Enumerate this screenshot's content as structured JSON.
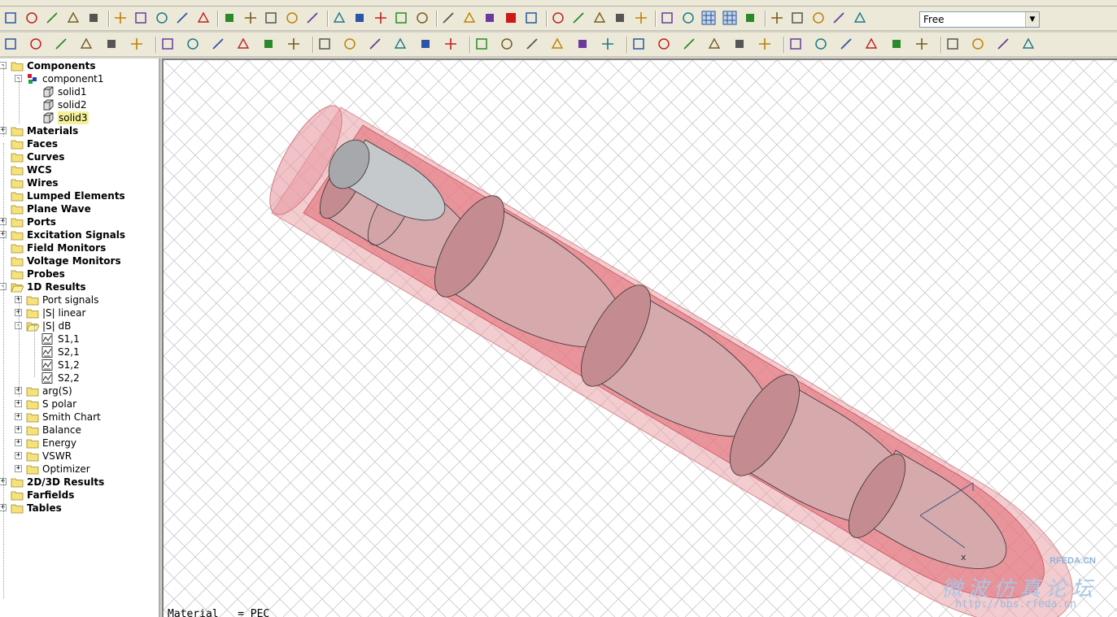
{
  "toolbar": {
    "view_mode": "Free",
    "row1_icons": [
      "open-folder-icon",
      "save-icon",
      "print-icon",
      "import-icon",
      "cut-icon",
      "paste-icon",
      "delete-icon",
      "undo-icon",
      "parameter-icon",
      "history-icon",
      "line-icon",
      "polyline-icon",
      "circle-icon",
      "ellipse-icon",
      "spline-icon",
      "edge-icon",
      "cross-edge-icon",
      "brick-icon",
      "pan-icon",
      "anchor-icon",
      "port-icon",
      "excitation-icon",
      "solver-icon",
      "stop-icon",
      "rotate-icon",
      "rotate-view-icon",
      "move-view-icon",
      "zoom-in-icon",
      "zoom-box-icon",
      "zoom-icon",
      "zoom-fit-icon",
      "glasses-icon",
      "axes-icon",
      "grid-icon",
      "wireframe-icon",
      "shade-icon",
      "cut-plane-icon",
      "transparency-icon",
      "link-icon",
      "unlink-icon"
    ],
    "row2_icons": [
      "pick-point-icon",
      "sphere-icon",
      "cylinder-icon",
      "cone-icon",
      "torus-icon",
      "ellipsoid-icon",
      "rotate-profile-icon",
      "extrude-icon",
      "loft-icon",
      "shape-icon",
      "boolean-add-icon",
      "boolean-subtract-icon",
      "boolean-intersect-icon",
      "boolean-insert-icon",
      "transform-icon",
      "align-icon",
      "mirror-icon",
      "units-icon",
      "background-icon",
      "boundary-icon",
      "symmetry-icon",
      "mesh-icon",
      "mesh-view-icon",
      "monitor-icon",
      "signal-icon",
      "template-icon",
      "time-domain-icon",
      "frequency-domain-icon",
      "eigenmode-icon",
      "result-icon",
      "coordinate-icon",
      "local-wcs-icon",
      "move-wcs-icon",
      "rotate-wcs-icon",
      "align-wcs-icon",
      "store-wcs-icon",
      "group-icon",
      "hide-icon",
      "show-icon",
      "properties-icon"
    ]
  },
  "tree": {
    "nodes": [
      {
        "label": "Components",
        "bold": true,
        "level": 0,
        "expander": "-",
        "icon": "folder-icon"
      },
      {
        "label": "component1",
        "bold": false,
        "level": 1,
        "expander": "-",
        "icon": "component-icon"
      },
      {
        "label": "solid1",
        "bold": false,
        "level": 2,
        "expander": "",
        "icon": "solid-icon"
      },
      {
        "label": "solid2",
        "bold": false,
        "level": 2,
        "expander": "",
        "icon": "solid-icon"
      },
      {
        "label": "solid3",
        "bold": false,
        "level": 2,
        "expander": "",
        "icon": "solid-icon",
        "selected": true
      },
      {
        "label": "Materials",
        "bold": true,
        "level": 0,
        "expander": "+",
        "icon": "folder-icon"
      },
      {
        "label": "Faces",
        "bold": true,
        "level": 0,
        "expander": "",
        "icon": "folder-icon"
      },
      {
        "label": "Curves",
        "bold": true,
        "level": 0,
        "expander": "",
        "icon": "folder-icon"
      },
      {
        "label": "WCS",
        "bold": true,
        "level": 0,
        "expander": "",
        "icon": "folder-icon"
      },
      {
        "label": "Wires",
        "bold": true,
        "level": 0,
        "expander": "",
        "icon": "folder-icon"
      },
      {
        "label": "Lumped Elements",
        "bold": true,
        "level": 0,
        "expander": "",
        "icon": "folder-icon"
      },
      {
        "label": "Plane Wave",
        "bold": true,
        "level": 0,
        "expander": "",
        "icon": "folder-icon"
      },
      {
        "label": "Ports",
        "bold": true,
        "level": 0,
        "expander": "+",
        "icon": "folder-icon"
      },
      {
        "label": "Excitation Signals",
        "bold": true,
        "level": 0,
        "expander": "+",
        "icon": "folder-icon"
      },
      {
        "label": "Field Monitors",
        "bold": true,
        "level": 0,
        "expander": "",
        "icon": "folder-icon"
      },
      {
        "label": "Voltage Monitors",
        "bold": true,
        "level": 0,
        "expander": "",
        "icon": "folder-icon"
      },
      {
        "label": "Probes",
        "bold": true,
        "level": 0,
        "expander": "",
        "icon": "folder-icon"
      },
      {
        "label": "1D Results",
        "bold": true,
        "level": 0,
        "expander": "-",
        "icon": "folder-open-icon"
      },
      {
        "label": "Port signals",
        "bold": false,
        "level": 1,
        "expander": "+",
        "icon": "folder-icon"
      },
      {
        "label": "|S| linear",
        "bold": false,
        "level": 1,
        "expander": "+",
        "icon": "folder-icon"
      },
      {
        "label": "|S| dB",
        "bold": false,
        "level": 1,
        "expander": "-",
        "icon": "folder-open-icon"
      },
      {
        "label": "S1,1",
        "bold": false,
        "level": 2,
        "expander": "",
        "icon": "result-chart-icon"
      },
      {
        "label": "S2,1",
        "bold": false,
        "level": 2,
        "expander": "",
        "icon": "result-chart-icon"
      },
      {
        "label": "S1,2",
        "bold": false,
        "level": 2,
        "expander": "",
        "icon": "result-chart-icon"
      },
      {
        "label": "S2,2",
        "bold": false,
        "level": 2,
        "expander": "",
        "icon": "result-chart-icon"
      },
      {
        "label": "arg(S)",
        "bold": false,
        "level": 1,
        "expander": "+",
        "icon": "folder-icon"
      },
      {
        "label": "S polar",
        "bold": false,
        "level": 1,
        "expander": "+",
        "icon": "folder-icon"
      },
      {
        "label": "Smith Chart",
        "bold": false,
        "level": 1,
        "expander": "+",
        "icon": "folder-icon"
      },
      {
        "label": "Balance",
        "bold": false,
        "level": 1,
        "expander": "+",
        "icon": "folder-icon"
      },
      {
        "label": "Energy",
        "bold": false,
        "level": 1,
        "expander": "+",
        "icon": "folder-icon"
      },
      {
        "label": "VSWR",
        "bold": false,
        "level": 1,
        "expander": "+",
        "icon": "folder-icon"
      },
      {
        "label": "Optimizer",
        "bold": false,
        "level": 1,
        "expander": "+",
        "icon": "folder-icon"
      },
      {
        "label": "2D/3D Results",
        "bold": true,
        "level": 0,
        "expander": "+",
        "icon": "folder-icon"
      },
      {
        "label": "Farfields",
        "bold": true,
        "level": 0,
        "expander": "",
        "icon": "folder-icon"
      },
      {
        "label": "Tables",
        "bold": true,
        "level": 0,
        "expander": "+",
        "icon": "folder-icon"
      }
    ]
  },
  "viewport": {
    "status_text": "Material   = PEC",
    "axis_label": "x",
    "watermark": {
      "site": "RFEDA.CN",
      "title": "微波仿真论坛",
      "url": "http://bbs.rfeda.cn"
    },
    "colors": {
      "outer_tube": "#e9a2a8",
      "inner_fill": "#e26d78",
      "disk_face": "#c48c91",
      "disk_side": "#d6a9ad",
      "port_face": "#a6a8ab"
    }
  }
}
